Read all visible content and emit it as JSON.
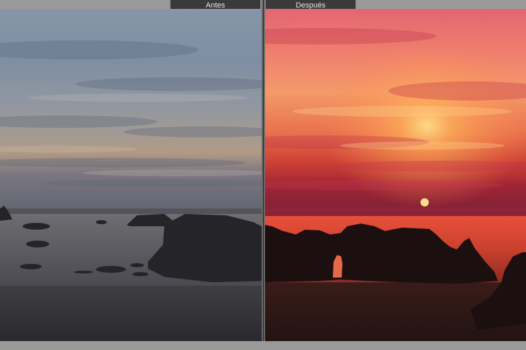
{
  "view": {
    "before_label": "Antes",
    "after_label": "Después"
  },
  "colors": {
    "chrome": "#9a9a9a",
    "label_bg": "#3a3a3a",
    "label_text": "#e6e6e6",
    "before_sky_top": "#8a9aae",
    "after_sky_top": "#e86a72",
    "after_sun": "#ffd07a"
  }
}
